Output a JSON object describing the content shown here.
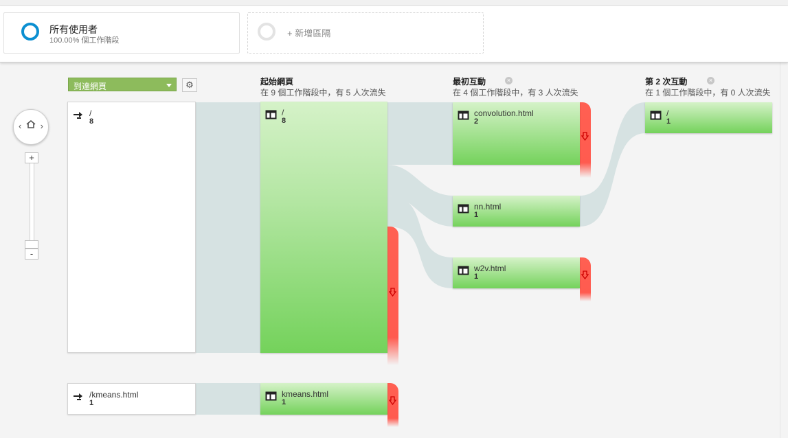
{
  "segments": [
    {
      "title": "所有使用者",
      "subtitle": "100.00% 個工作階段"
    },
    {
      "add_label": "+ 新增區隔"
    }
  ],
  "zoom": {
    "plus": "+",
    "minus": "-",
    "home_icon": "home-icon",
    "left_icon": "chevron-left-icon",
    "right_icon": "chevron-right-icon"
  },
  "landing": {
    "dropdown_label": "到達網頁",
    "settings_icon": "gear-icon"
  },
  "columns": [
    {
      "title": "起始網頁",
      "subtitle": "在 9 個工作階段中，有 5 人次流失"
    },
    {
      "title": "最初互動",
      "subtitle": "在 4 個工作階段中，有 3 人次流失"
    },
    {
      "title": "第 2 次互動",
      "subtitle": "在 1 個工作階段中，有 0 人次流失"
    }
  ],
  "landing_nodes": [
    {
      "name": "/",
      "count": "8"
    },
    {
      "name": "/kmeans.html",
      "count": "1"
    }
  ],
  "start_nodes": [
    {
      "name": "/",
      "count": "8"
    },
    {
      "name": "kmeans.html",
      "count": "1"
    }
  ],
  "first_nodes": [
    {
      "name": "convolution.html",
      "count": "2"
    },
    {
      "name": "nn.html",
      "count": "1"
    },
    {
      "name": "w2v.html",
      "count": "1"
    }
  ],
  "second_nodes": [
    {
      "name": "/",
      "count": "1"
    }
  ],
  "colors": {
    "accent": "#0b8fd1",
    "node_green": "#74d25b",
    "dropoff": "#ff5b4f",
    "flow": "#d6e2e2",
    "dropdown": "#8dbb5c"
  }
}
